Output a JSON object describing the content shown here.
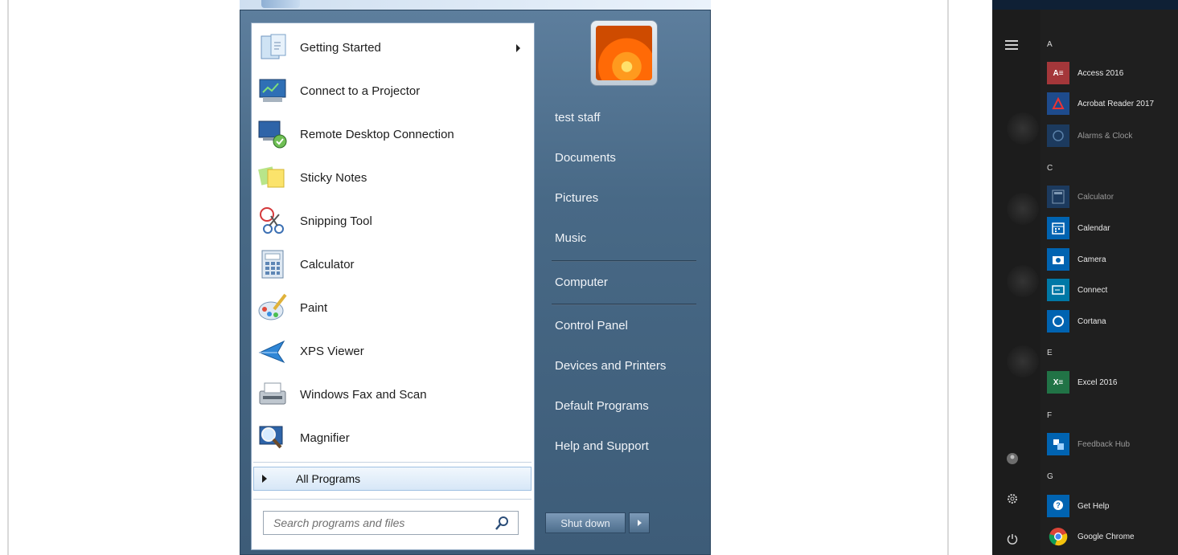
{
  "win7": {
    "programs": [
      {
        "label": "Getting Started",
        "icon": "getting-started-icon",
        "has_submenu": true
      },
      {
        "label": "Connect to a Projector",
        "icon": "projector-icon",
        "has_submenu": false
      },
      {
        "label": "Remote Desktop Connection",
        "icon": "remote-desktop-icon",
        "has_submenu": false
      },
      {
        "label": "Sticky Notes",
        "icon": "sticky-notes-icon",
        "has_submenu": false
      },
      {
        "label": "Snipping Tool",
        "icon": "scissors-icon",
        "has_submenu": false
      },
      {
        "label": "Calculator",
        "icon": "calculator-icon",
        "has_submenu": false
      },
      {
        "label": "Paint",
        "icon": "paint-icon",
        "has_submenu": false
      },
      {
        "label": "XPS Viewer",
        "icon": "xps-viewer-icon",
        "has_submenu": false
      },
      {
        "label": "Windows Fax and Scan",
        "icon": "fax-icon",
        "has_submenu": false
      },
      {
        "label": "Magnifier",
        "icon": "magnifier-icon",
        "has_submenu": false
      }
    ],
    "all_programs_label": "All Programs",
    "search_placeholder": "Search programs and files",
    "right_items": [
      "test staff",
      "Documents",
      "Pictures",
      "Music",
      "Computer",
      "Control Panel",
      "Devices and Printers",
      "Default Programs",
      "Help and Support"
    ],
    "shutdown_label": "Shut down",
    "colors": {
      "panel": "#486986",
      "highlight": "#d7e7f7"
    }
  },
  "win10": {
    "groups": [
      {
        "header": "A",
        "apps": [
          {
            "label": "Access 2016",
            "tile_text": "A≡",
            "color": "#a4373a",
            "dim": false
          },
          {
            "label": "Acrobat Reader 2017",
            "tile_text": "⌂",
            "color": "#1e4b8c",
            "dim": false
          },
          {
            "label": "Alarms & Clock",
            "tile_text": "◷",
            "color": "#1c3a5e",
            "dim": true
          }
        ]
      },
      {
        "header": "C",
        "apps": [
          {
            "label": "Calculator",
            "tile_text": "▦",
            "color": "#1c3a5e",
            "dim": true
          },
          {
            "label": "Calendar",
            "tile_text": "▤",
            "color": "#0063b1",
            "dim": false
          },
          {
            "label": "Camera",
            "tile_text": "◉",
            "color": "#0063b1",
            "dim": false
          },
          {
            "label": "Connect",
            "tile_text": "▭",
            "color": "#0078a6",
            "dim": false
          },
          {
            "label": "Cortana",
            "tile_text": "○",
            "color": "#0063b1",
            "dim": false
          }
        ]
      },
      {
        "header": "E",
        "apps": [
          {
            "label": "Excel 2016",
            "tile_text": "X≡",
            "color": "#217346",
            "dim": false
          }
        ]
      },
      {
        "header": "F",
        "apps": [
          {
            "label": "Feedback Hub",
            "tile_text": "☺",
            "color": "#0063b1",
            "dim": true
          }
        ]
      },
      {
        "header": "G",
        "apps": [
          {
            "label": "Get Help",
            "tile_text": "?",
            "color": "#0063b1",
            "dim": false
          },
          {
            "label": "Google Chrome",
            "tile_text": "●",
            "color": "#1f1f1f",
            "dim": false
          }
        ]
      }
    ],
    "rail_icons": [
      "hamburger-icon",
      "user-icon",
      "settings-icon",
      "power-icon"
    ]
  }
}
